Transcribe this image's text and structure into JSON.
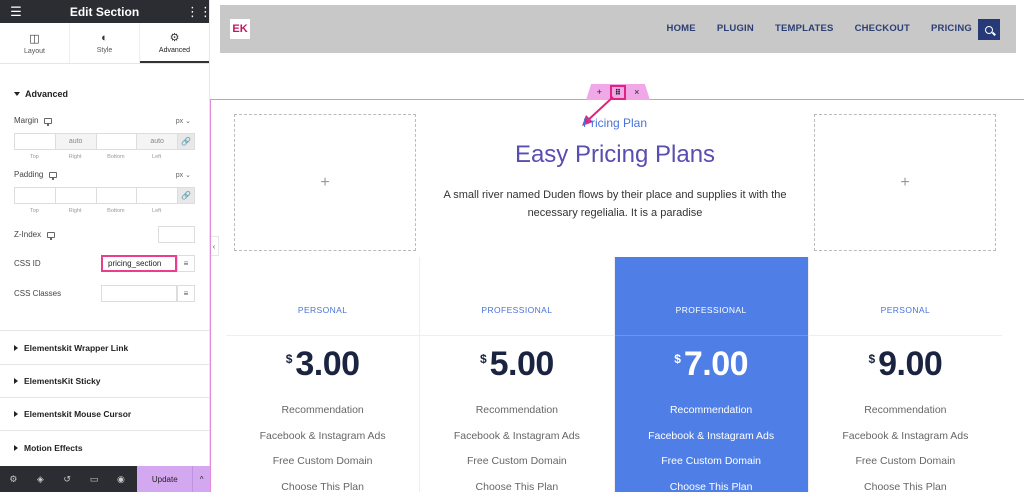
{
  "panel": {
    "title": "Edit Section",
    "tabs": [
      {
        "label": "Layout"
      },
      {
        "label": "Style"
      },
      {
        "label": "Advanced"
      }
    ],
    "section_title": "Advanced",
    "margin": {
      "label": "Margin",
      "unit": "px",
      "values": [
        "",
        "auto",
        "",
        "auto"
      ],
      "sides": [
        "Top",
        "Right",
        "Bottom",
        "Left"
      ]
    },
    "padding": {
      "label": "Padding",
      "unit": "px",
      "values": [
        "",
        "",
        "",
        ""
      ],
      "sides": [
        "Top",
        "Right",
        "Bottom",
        "Left"
      ]
    },
    "zindex": {
      "label": "Z-Index",
      "value": ""
    },
    "css_id": {
      "label": "CSS ID",
      "value": "pricing_section"
    },
    "css_classes": {
      "label": "CSS Classes",
      "value": ""
    },
    "collapsed_sections": [
      "Elementskit Wrapper Link",
      "ElementsKit Sticky",
      "Elementskit Mouse Cursor",
      "Motion Effects"
    ],
    "footer": {
      "update_label": "Update"
    }
  },
  "site": {
    "logo_text": "EK",
    "nav": [
      "HOME",
      "PLUGIN",
      "TEMPLATES",
      "CHECKOUT",
      "PRICING"
    ]
  },
  "hero": {
    "subtitle": "Pricing Plan",
    "title": "Easy Pricing Plans",
    "text": "A small river named Duden flows by their place and supplies it with the necessary regelialia. It is a paradise"
  },
  "plans": [
    {
      "name": "PERSONAL",
      "currency": "$",
      "price": "3.00",
      "featured": false
    },
    {
      "name": "PROFESSIONAL",
      "currency": "$",
      "price": "5.00",
      "featured": false
    },
    {
      "name": "PROFESSIONAL",
      "currency": "$",
      "price": "7.00",
      "featured": true
    },
    {
      "name": "PERSONAL",
      "currency": "$",
      "price": "9.00",
      "featured": false
    }
  ],
  "plan_features": [
    "Recommendation",
    "Facebook & Instagram Ads",
    "Free Custom Domain",
    "Choose This Plan"
  ],
  "colors": {
    "accent": "#4f7fe6",
    "title": "#5a4db1",
    "highlight": "#e83e8c",
    "panel_dark": "#2b2d33"
  }
}
